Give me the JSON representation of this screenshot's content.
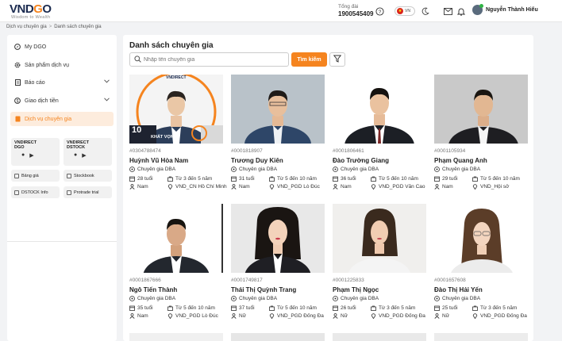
{
  "header": {
    "logo_main": "VNDGO",
    "logo_tagline": "Wisdom to Wealth",
    "hotline_label": "Tổng đài",
    "hotline_number": "1900545409",
    "language": "VN",
    "user_name": "Nguyễn Thành Hiếu"
  },
  "breadcrumb": {
    "items": [
      "Dịch vụ chuyên gia",
      "Danh sách chuyên gia"
    ],
    "separator": ">"
  },
  "sidebar": {
    "items": [
      {
        "label": "My DGO",
        "icon": "compass-icon"
      },
      {
        "label": "Sản phẩm dịch vụ",
        "icon": "gear-icon"
      },
      {
        "label": "Báo cáo",
        "icon": "report-icon"
      },
      {
        "label": "Giao dịch tiền",
        "icon": "money-icon"
      },
      {
        "label": "Dịch vụ chuyên gia",
        "icon": "doc-icon",
        "active": true
      }
    ],
    "apps": [
      {
        "name_line1": "VNDIRECT",
        "name_line2": "DGO"
      },
      {
        "name_line1": "VNDIRECT",
        "name_line2": "DSTOCK"
      }
    ],
    "tools": [
      "Bảng giá",
      "Stockbook",
      "DSTOCK Info",
      "Protrade trial"
    ]
  },
  "main": {
    "title": "Danh sách chuyên gia",
    "search_placeholder": "Nhập tên chuyên gia",
    "search_button": "Tìm kiếm"
  },
  "experts": [
    {
      "code": "#0304788474",
      "name": "Huỳnh Vũ Hòa Nam",
      "role": "Chuyên gia DBA",
      "age": "28 tuổi",
      "experience": "Từ 3 đến 5 năm",
      "gender": "Nam",
      "branch": "VND_CN Hồ Chí Minh",
      "photo_overlay": "10",
      "photo_caption": "KHÁT VỌNG",
      "photo_brand": "VNDIRECT"
    },
    {
      "code": "#0001818907",
      "name": "Trương Duy Kiên",
      "role": "Chuyên gia DBA",
      "age": "31 tuổi",
      "experience": "Từ 5 đến 10 năm",
      "gender": "Nam",
      "branch": "VND_PGD Lò Đúc"
    },
    {
      "code": "#0001806461",
      "name": "Đào Trường Giang",
      "role": "Chuyên gia DBA",
      "age": "36 tuổi",
      "experience": "Từ 5 đến 10 năm",
      "gender": "Nam",
      "branch": "VND_PGD Văn Cao"
    },
    {
      "code": "#0001105934",
      "name": "Phạm Quang Anh",
      "role": "Chuyên gia DBA",
      "age": "29 tuổi",
      "experience": "Từ 5 đến 10 năm",
      "gender": "Nam",
      "branch": "VND_Hội sở"
    },
    {
      "code": "#0001867666",
      "name": "Ngô Tiến Thành",
      "role": "Chuyên gia DBA",
      "age": "35 tuổi",
      "experience": "Từ 5 đến 10 năm",
      "gender": "Nam",
      "branch": "VND_PGD Lò Đúc"
    },
    {
      "code": "#0001749817",
      "name": "Thái Thị Quỳnh Trang",
      "role": "Chuyên gia DBA",
      "age": "37 tuổi",
      "experience": "Từ 5 đến 10 năm",
      "gender": "Nữ",
      "branch": "VND_PGD Đống Đa"
    },
    {
      "code": "#0001225833",
      "name": "Phạm Thị Ngọc",
      "role": "Chuyên gia DBA",
      "age": "26 tuổi",
      "experience": "Từ 3 đến 5 năm",
      "gender": "Nữ",
      "branch": "VND_PGD Đống Đa"
    },
    {
      "code": "#0001657608",
      "name": "Đào Thị Hải Yến",
      "role": "Chuyên gia DBA",
      "age": "25 tuổi",
      "experience": "Từ 3 đến 5 năm",
      "gender": "Nữ",
      "branch": "VND_PGD Đống Đa"
    }
  ],
  "colors": {
    "accent": "#f5841f",
    "active_bg": "#fdecdd",
    "page_bg": "#f2f3f5",
    "brand_dark": "#1a2a4f"
  }
}
